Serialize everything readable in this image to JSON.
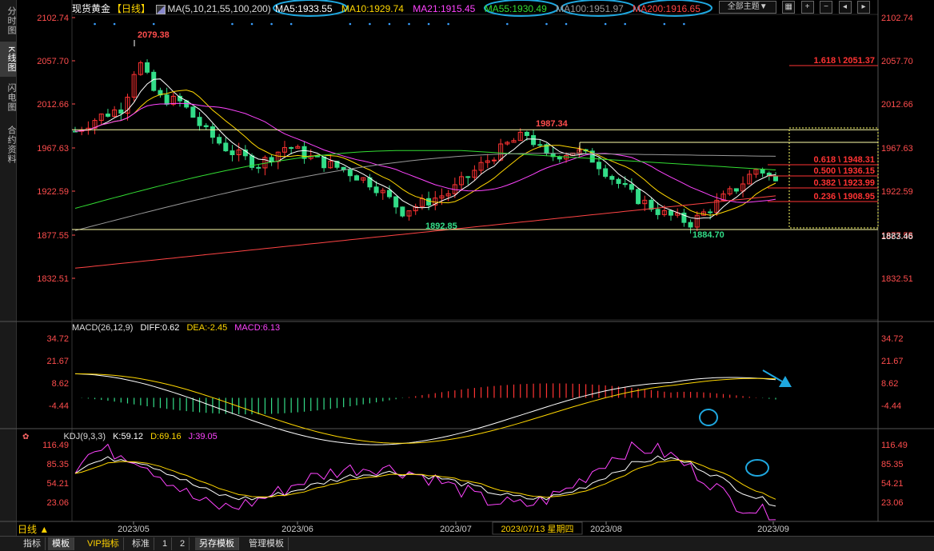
{
  "sidebar": {
    "tabs": [
      {
        "label": "分时图",
        "active": false
      },
      {
        "label": "K线图",
        "active": true
      },
      {
        "label": "闪电图",
        "active": false
      },
      {
        "label": "合约资料",
        "active": false
      }
    ]
  },
  "header": {
    "instrument": "现货黄金",
    "period_tag": "【日线】",
    "ma_params": "MA(5,10,21,55,100,200)",
    "ma_values": [
      {
        "label": "MA5:1933.55",
        "color": "#ffffff"
      },
      {
        "label": "MA10:1929.74",
        "color": "#ffd700"
      },
      {
        "label": "MA21:1915.45",
        "color": "#ff44ff"
      },
      {
        "label": "MA55:1930.49",
        "color": "#33dd33"
      },
      {
        "label": "MA100:1951.97",
        "color": "#999999"
      },
      {
        "label": "MA200:1916.65",
        "color": "#ff4444"
      }
    ],
    "theme_select": "全部主题▼"
  },
  "price_axis": {
    "ticks": [
      "2102.74",
      "2057.70",
      "2012.66",
      "1967.63",
      "1922.59",
      "1877.55",
      "1832.51"
    ],
    "current_price_label": "1883.46"
  },
  "annotations": {
    "high": "2079.38",
    "mid_high": "1987.34",
    "low1": "1892.85",
    "low2": "1884.70",
    "fib": [
      "1.618 \\ 2051.37",
      "0.618 \\ 1948.31",
      "0.500 \\ 1936.15",
      "0.382 \\ 1923.99",
      "0.236 \\ 1908.95"
    ]
  },
  "macd": {
    "label": "MACD(26,12,9)",
    "diff": "DIFF:0.62",
    "dea": "DEA:-2.45",
    "macd": "MACD:6.13",
    "ticks": [
      "34.72",
      "21.67",
      "8.62",
      "-4.44"
    ]
  },
  "kdj": {
    "label": "KDJ(9,3,3)",
    "k": "K:59.12",
    "d": "D:69.16",
    "j": "J:39.05",
    "ticks": [
      "116.49",
      "85.35",
      "54.21",
      "23.06"
    ]
  },
  "time_axis": {
    "labels": [
      "2023/05",
      "2023/06",
      "2023/07",
      "2023/08",
      "2023/09"
    ],
    "cursor_label": "2023/07/13 星期四"
  },
  "period_label": "日线 ▲",
  "bottom_tabs": [
    {
      "label": "指标",
      "active": false
    },
    {
      "label": "模板",
      "active": true
    },
    {
      "label": "VIP指标",
      "active": false
    },
    {
      "label": "标准",
      "active": false
    },
    {
      "label": "1",
      "active": false
    },
    {
      "label": "2",
      "active": false
    },
    {
      "label": "另存模板",
      "active": true
    },
    {
      "label": "管理模板",
      "active": false
    }
  ],
  "colors": {
    "up": "#ff3333",
    "down": "#33dd88",
    "ma5": "#ffffff",
    "ma10": "#ffd700",
    "ma21": "#ff44ff",
    "ma55": "#33dd33",
    "ma100": "#999999",
    "ma200": "#ff4444",
    "highlight": "#1fa8e0"
  }
}
